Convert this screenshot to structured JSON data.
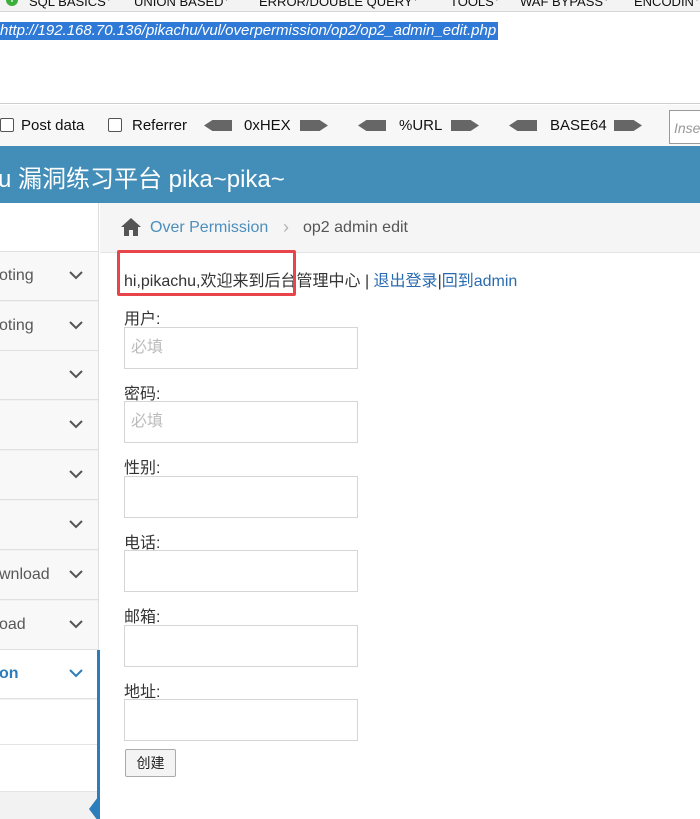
{
  "hackbar": {
    "menu": [
      "SQL BASICS",
      "UNION BASED",
      "ERROR/DOUBLE QUERY",
      "TOOLS",
      "WAF BYPASS",
      "ENCODIN"
    ],
    "url": "http://192.168.70.136/pikachu/vul/overpermission/op2/op2_admin_edit.php",
    "options": {
      "post_data": "Post data",
      "referrer": "Referrer",
      "hex": "0xHEX",
      "url_enc": "%URL",
      "base64": "BASE64",
      "insert_placeholder": "Inse"
    }
  },
  "app": {
    "title": "u 漏洞练习平台 pika~pika~"
  },
  "sidebar": {
    "items": [
      {
        "label": ""
      },
      {
        "label": "oting"
      },
      {
        "label": ""
      },
      {
        "label": ""
      },
      {
        "label": ""
      },
      {
        "label": ""
      },
      {
        "label": "wnload"
      },
      {
        "label": "oad"
      },
      {
        "label": "on"
      }
    ]
  },
  "breadcrumb": {
    "parent": "Over Permission",
    "current": "op2 admin edit"
  },
  "welcome": {
    "text": "hi,pikachu,欢迎来到后台管理中心",
    "sep1": " | ",
    "logout": "退出登录",
    "sep2": "|",
    "back": "回到admin"
  },
  "form": {
    "fields": [
      {
        "label": "用户:",
        "placeholder": "必填",
        "value": ""
      },
      {
        "label": "密码:",
        "placeholder": "必填",
        "value": ""
      },
      {
        "label": "性别:",
        "placeholder": "",
        "value": ""
      },
      {
        "label": "电话:",
        "placeholder": "",
        "value": ""
      },
      {
        "label": "邮箱:",
        "placeholder": "",
        "value": ""
      },
      {
        "label": "地址:",
        "placeholder": "",
        "value": ""
      }
    ],
    "submit": "创建"
  },
  "colors": {
    "header": "#438eb9",
    "link": "#2a6bb0",
    "highlight": "#e8454a",
    "url_selection": "#2f7ad6"
  }
}
